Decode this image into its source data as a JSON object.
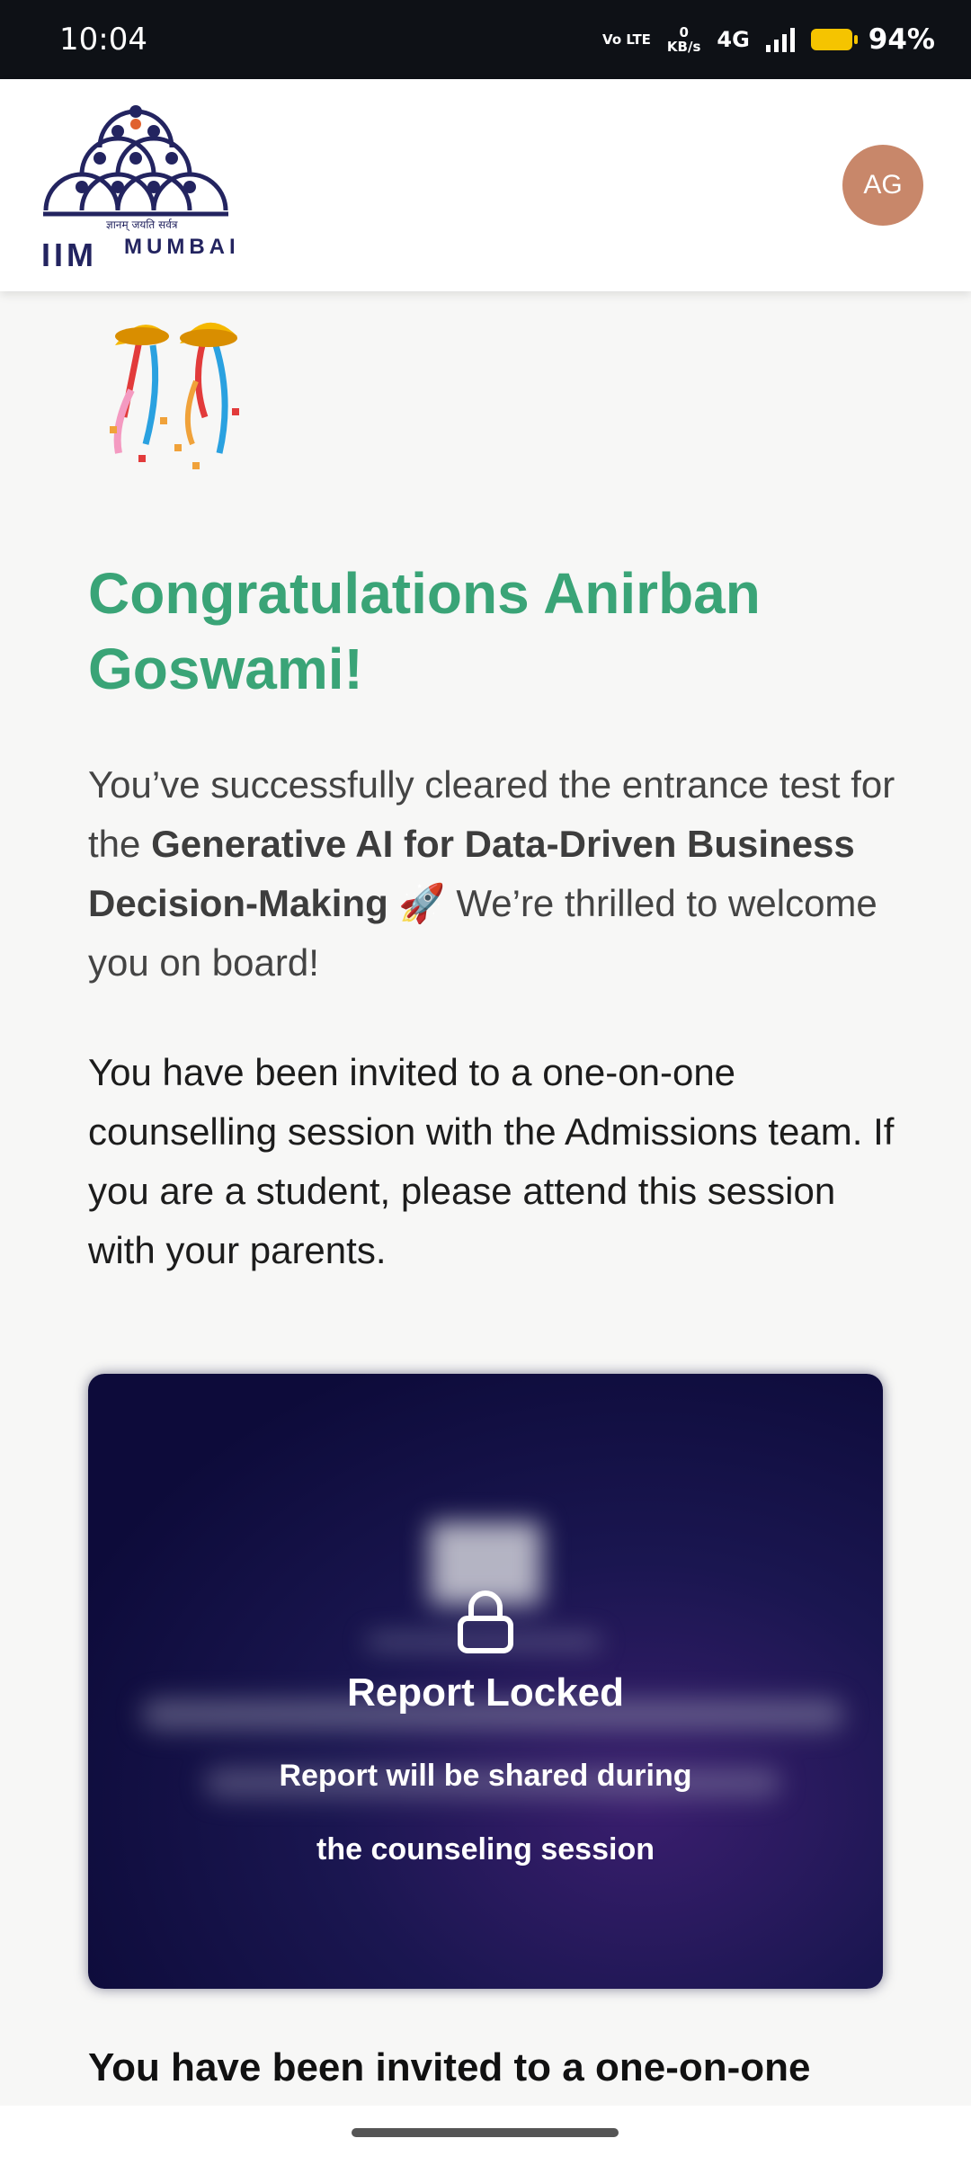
{
  "status_bar": {
    "time": "10:04",
    "volte": "Vo LTE",
    "net_speed_value": "0",
    "net_speed_unit": "KB/s",
    "network": "4G",
    "battery": "94%",
    "battery_color": "#f5c400"
  },
  "header": {
    "logo_tagline": "ज्ञानम् जयति सर्वत्र",
    "logo_left": "IIM",
    "logo_right": "MUMBAI",
    "avatar_initials": "AG",
    "avatar_color": "#c8876a"
  },
  "main": {
    "confetti_icon": "party-popper",
    "heading": "Congratulations Anirban Goswami!",
    "heading_color": "#3aa477",
    "para1_intro": "You’ve successfully cleared the entrance test for the ",
    "para1_program": "Generative AI for Data-Driven Business Decision-Making",
    "para1_emoji": "🚀",
    "para1_outro": " We’re thrilled to welcome you on board!",
    "para2": "You have been invited to a one-on-one counselling session with the Admissions team. If you are a student, please attend this session with your parents.",
    "report_card": {
      "lock_icon": "lock-icon",
      "title": "Report Locked",
      "subtitle": "Report will be shared during the counseling session"
    },
    "para3": "You have been invited to a one-on-one"
  }
}
